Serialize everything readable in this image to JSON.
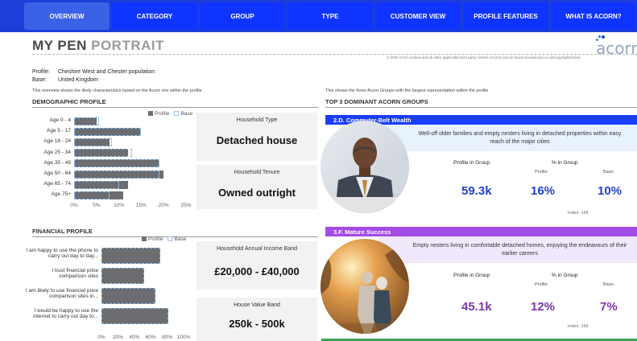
{
  "nav": {
    "tabs": [
      {
        "label": "OVERVIEW",
        "active": true
      },
      {
        "label": "CATEGORY",
        "active": false
      },
      {
        "label": "GROUP",
        "active": false
      },
      {
        "label": "TYPE",
        "active": false
      },
      {
        "label": "CUSTOMER VIEW",
        "active": false
      },
      {
        "label": "PROFILE FEATURES",
        "active": false
      },
      {
        "label": "WHAT IS ACORN?",
        "active": false
      }
    ]
  },
  "header": {
    "title_part1": "MY PEN",
    "title_part2": "PORTRAIT",
    "logo_text": "acorn",
    "copyright": "© 2026 CACI Limited and all other applicable third party notices (Acorn) can be found at www.caci.co.uk/copyrightnotices"
  },
  "meta": {
    "profile_key": "Profile:",
    "profile_value": "Cheshire West and Chester population",
    "base_key": "Base:",
    "base_value": "United Kingdom",
    "left_note": "This overview shows the likely characteristics based on the Acorn mix within the profile",
    "right_note": "This shows the three Acorn Groups with the largest representation within the profile"
  },
  "demographic": {
    "heading": "DEMOGRAPHIC PROFILE",
    "legend_profile": "Profile",
    "legend_base": "Base",
    "household_type_label": "Household Type",
    "household_type_value": "Detached house",
    "household_tenure_label": "Household Tenure",
    "household_tenure_value": "Owned outright"
  },
  "financial": {
    "heading": "FINANCIAL PROFILE",
    "legend_profile": "Profile",
    "legend_base": "Base",
    "income_label": "Household Annual Income Band",
    "income_value": "£20,000 - £40,000",
    "house_value_label": "House Value Band",
    "house_value_value": "250k - 500k"
  },
  "groups": {
    "heading": "TOP 3 DOMINANT ACORN GROUPS",
    "profile_in_group_label": "Profile in Group",
    "pct_in_group_label": "% in Group",
    "profile_sub": "Profile:",
    "base_sub": "Base:",
    "g1": {
      "title": "2.D. Commuter-Belt Wealth",
      "description": "Well-off older families and empty nesters living in detached properties within easy reach of the major cities",
      "profile_count": "59.3k",
      "pct_profile": "16%",
      "pct_base": "10%",
      "index": "Index: 165"
    },
    "g2": {
      "title": "3.F. Mature Success",
      "description": "Empty nesters living in comfortable detached homes, enjoying the endeavours of their earlier careers",
      "profile_count": "45.1k",
      "pct_profile": "12%",
      "pct_base": "7%",
      "index": "Index: 166"
    },
    "accent_blue": "#1a3ef5",
    "accent_purple": "#a34be3"
  },
  "chart_data": [
    {
      "type": "bar",
      "orientation": "horizontal",
      "categories": [
        "Age 0 - 4",
        "Age 5 - 17",
        "Age 18 - 24",
        "Age 25 - 34",
        "Age 35 - 49",
        "Age 50 - 64",
        "Age 65 - 74",
        "Age 75+"
      ],
      "series": [
        {
          "name": "Profile",
          "values": [
            5,
            15,
            8,
            12,
            19,
            20,
            12,
            11
          ]
        },
        {
          "name": "Base",
          "values": [
            5.5,
            15,
            8.5,
            13,
            19,
            19,
            10,
            8
          ]
        }
      ],
      "xlim": [
        0,
        25
      ],
      "ticks": [
        "0%",
        "5%",
        "10%",
        "15%",
        "20%",
        "25%"
      ],
      "legend": "top-right"
    },
    {
      "type": "bar",
      "orientation": "horizontal",
      "categories": [
        "I am happy to use the phone to carry out day to day...",
        "I trust financial price comparison sites",
        "I am likely to use financial price comparison sites in...",
        "I would be happy to use the internet to carry out day to..."
      ],
      "series": [
        {
          "name": "Profile",
          "values": [
            72,
            52,
            66,
            81
          ]
        },
        {
          "name": "Base",
          "values": [
            72,
            52,
            66,
            81
          ]
        }
      ],
      "xlim": [
        0,
        100
      ],
      "ticks": [
        "0%",
        "20%",
        "40%",
        "60%",
        "80%",
        "100%"
      ],
      "legend": "top-right"
    }
  ]
}
